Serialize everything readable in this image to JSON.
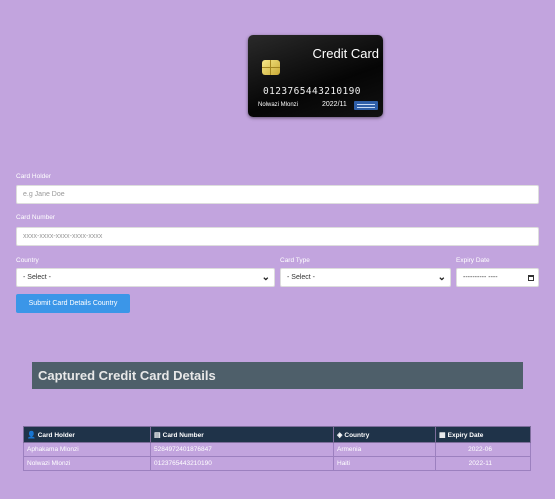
{
  "card": {
    "title": "Credit Card",
    "number": "0123765443210190",
    "holder": "Nolwazi Mlonzi",
    "expiry": "2022/11"
  },
  "form": {
    "holder_label": "Card Holder",
    "holder_placeholder": "e.g Jane Doe",
    "number_label": "Card Number",
    "number_placeholder": "xxxx-xxxx-xxxx-xxxx-xxxx",
    "country_label": "Country",
    "country_value": "- Select -",
    "type_label": "Card Type",
    "type_value": "- Select -",
    "expiry_label": "Expiry Date",
    "expiry_value": "---------- ----",
    "submit_label": "Submit Card Details Country"
  },
  "captured": {
    "title": "Captured Credit Card Details",
    "headers": [
      "Card Holder",
      "Card Number",
      "Country",
      "Expiry Date"
    ],
    "header_icons": [
      "user-icon",
      "credit-card-icon",
      "globe-icon",
      "calendar-icon"
    ],
    "rows": [
      [
        "Aphakama Mlonzi",
        "5284972401876847",
        "Armenia",
        "2022-06"
      ],
      [
        "Nolwazi Mlonzi",
        "0123765443210190",
        "Haiti",
        "2022-11"
      ]
    ]
  }
}
